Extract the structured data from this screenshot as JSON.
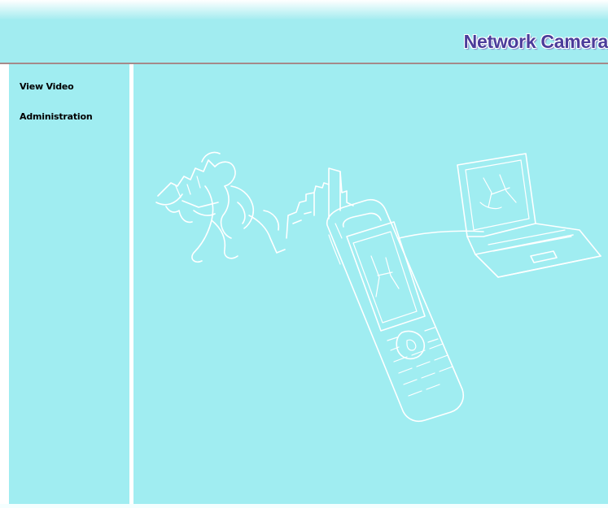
{
  "header": {
    "title": "Network Camera"
  },
  "sidebar": {
    "items": [
      {
        "label": "View Video"
      },
      {
        "label": "Administration"
      }
    ]
  },
  "colors": {
    "background": "#a0edf1",
    "title": "#4b3c9a",
    "rule": "#a58a8a"
  }
}
